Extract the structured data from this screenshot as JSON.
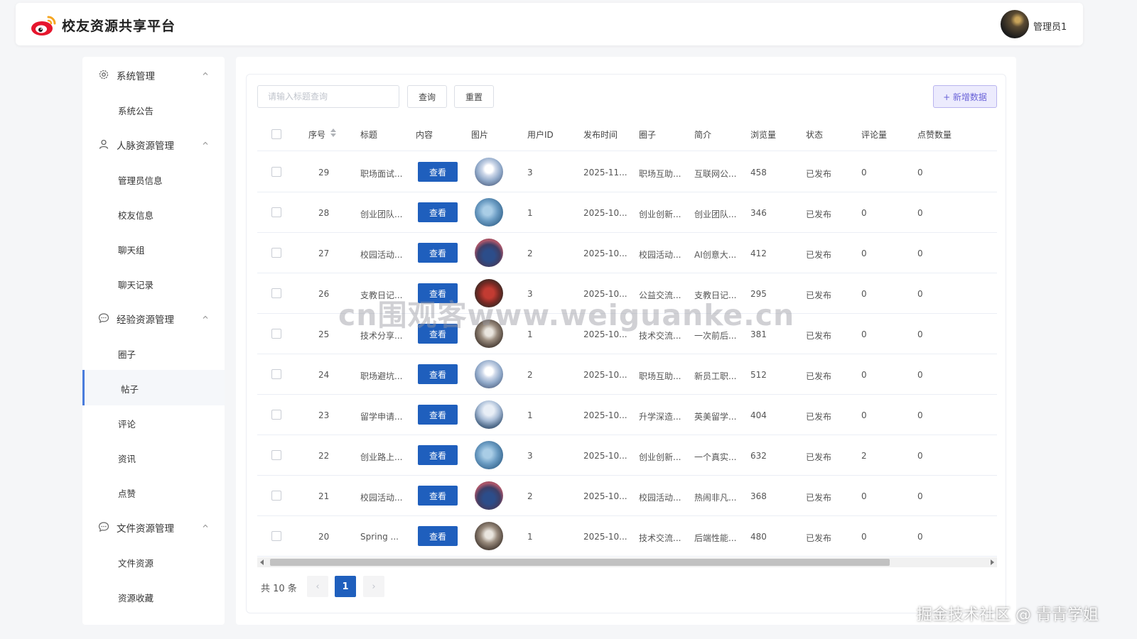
{
  "app": {
    "title": "校友资源共享平台"
  },
  "user": {
    "name": "管理员1"
  },
  "sidebar": {
    "groups": [
      {
        "label": "系统管理",
        "icon": "gear-icon",
        "items": [
          "系统公告"
        ]
      },
      {
        "label": "人脉资源管理",
        "icon": "user-icon",
        "items": [
          "管理员信息",
          "校友信息",
          "聊天组",
          "聊天记录"
        ]
      },
      {
        "label": "经验资源管理",
        "icon": "chat-icon",
        "items": [
          "圈子",
          "帖子",
          "评论",
          "资讯",
          "点赞"
        ]
      },
      {
        "label": "文件资源管理",
        "icon": "chat-icon",
        "items": [
          "文件资源",
          "资源收藏"
        ]
      }
    ],
    "active_item": "帖子"
  },
  "toolbar": {
    "search_placeholder": "请输入标题查询",
    "query_label": "查询",
    "reset_label": "重置",
    "add_label": "+ 新增数据"
  },
  "table": {
    "headers": [
      "序号",
      "标题",
      "内容",
      "图片",
      "用户ID",
      "发布时间",
      "圈子",
      "简介",
      "浏览量",
      "状态",
      "评论量",
      "点赞数量"
    ],
    "view_label": "查看",
    "rows": [
      {
        "id": "29",
        "title": "职场面试...",
        "user_id": "3",
        "time": "2025-11...",
        "circle": "职场互助...",
        "intro": "互联网公...",
        "views": "458",
        "status": "已发布",
        "comments": "0",
        "likes": "0",
        "img": "a"
      },
      {
        "id": "28",
        "title": "创业团队...",
        "user_id": "1",
        "time": "2025-10...",
        "circle": "创业创新...",
        "intro": "创业团队...",
        "views": "346",
        "status": "已发布",
        "comments": "0",
        "likes": "0",
        "img": "b"
      },
      {
        "id": "27",
        "title": "校园活动...",
        "user_id": "2",
        "time": "2025-10...",
        "circle": "校园活动...",
        "intro": "AI创意大...",
        "views": "412",
        "status": "已发布",
        "comments": "0",
        "likes": "0",
        "img": "c"
      },
      {
        "id": "26",
        "title": "支教日记...",
        "user_id": "3",
        "time": "2025-10...",
        "circle": "公益交流...",
        "intro": "支教日记...",
        "views": "295",
        "status": "已发布",
        "comments": "0",
        "likes": "0",
        "img": "d"
      },
      {
        "id": "25",
        "title": "技术分享...",
        "user_id": "1",
        "time": "2025-10...",
        "circle": "技术交流...",
        "intro": "一次前后...",
        "views": "381",
        "status": "已发布",
        "comments": "0",
        "likes": "0",
        "img": "e"
      },
      {
        "id": "24",
        "title": "职场避坑...",
        "user_id": "2",
        "time": "2025-10...",
        "circle": "职场互助...",
        "intro": "新员工职...",
        "views": "512",
        "status": "已发布",
        "comments": "0",
        "likes": "0",
        "img": "a"
      },
      {
        "id": "23",
        "title": "留学申请...",
        "user_id": "1",
        "time": "2025-10...",
        "circle": "升学深造...",
        "intro": "英美留学...",
        "views": "404",
        "status": "已发布",
        "comments": "0",
        "likes": "0",
        "img": "f"
      },
      {
        "id": "22",
        "title": "创业路上...",
        "user_id": "3",
        "time": "2025-10...",
        "circle": "创业创新...",
        "intro": "一个真实...",
        "views": "632",
        "status": "已发布",
        "comments": "2",
        "likes": "0",
        "img": "b"
      },
      {
        "id": "21",
        "title": "校园活动...",
        "user_id": "2",
        "time": "2025-10...",
        "circle": "校园活动...",
        "intro": "热闹非凡...",
        "views": "368",
        "status": "已发布",
        "comments": "0",
        "likes": "0",
        "img": "c"
      },
      {
        "id": "20",
        "title": "Spring ...",
        "user_id": "1",
        "time": "2025-10...",
        "circle": "技术交流...",
        "intro": "后端性能...",
        "views": "480",
        "status": "已发布",
        "comments": "0",
        "likes": "0",
        "img": "e"
      }
    ]
  },
  "pagination": {
    "total_text": "共 10 条",
    "current_page": "1",
    "prev_icon": "‹",
    "next_icon": "›"
  },
  "overlay": {
    "watermark": "cn围观客www.weiguanke.cn",
    "corner_credit": "掘金技术社区 @ 青青学姐"
  },
  "colors": {
    "primary": "#1f5fbd",
    "active_bar": "#4a7cdc",
    "add_button_bg": "#ecebfd",
    "add_button_text": "#6a63d8"
  }
}
